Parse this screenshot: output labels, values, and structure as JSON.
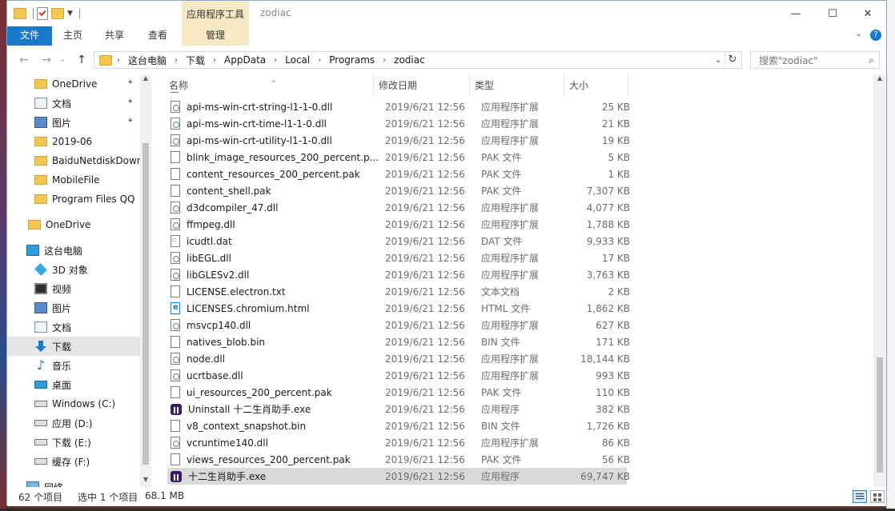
{
  "window": {
    "title": "zodiac",
    "tool_tab": "应用程序工具",
    "minimize": "—",
    "maximize": "☐",
    "close": "✕"
  },
  "ribbon": {
    "tabs": [
      {
        "label": "文件"
      },
      {
        "label": "主页"
      },
      {
        "label": "共享"
      },
      {
        "label": "查看"
      },
      {
        "label": "管理"
      }
    ],
    "expand": "⌄",
    "help": "?"
  },
  "nav": {
    "back": "←",
    "forward": "→",
    "history": "⌄",
    "up": "↑"
  },
  "address": {
    "crumbs": [
      "这台电脑",
      "下载",
      "AppData",
      "Local",
      "Programs",
      "zodiac"
    ],
    "dropdown": "⌄",
    "refresh": "↻"
  },
  "search": {
    "placeholder": "搜索\"zodiac\"",
    "icon": "⌕"
  },
  "sidebar": {
    "items": [
      {
        "label": "OneDrive",
        "icon": "folder-icon",
        "pinned": true
      },
      {
        "label": "文档",
        "icon": "document-icon",
        "pinned": true
      },
      {
        "label": "图片",
        "icon": "picture-icon",
        "pinned": true
      },
      {
        "label": "2019-06",
        "icon": "folder-icon",
        "pinned": false
      },
      {
        "label": "BaiduNetdiskDown",
        "icon": "folder-icon",
        "pinned": false
      },
      {
        "label": "MobileFile",
        "icon": "folder-icon",
        "pinned": false
      },
      {
        "label": "Program Files QQ",
        "icon": "folder-icon",
        "pinned": false
      },
      {
        "label": "OneDrive",
        "icon": "folder-icon",
        "pinned": false
      },
      {
        "label": "这台电脑",
        "icon": "computer-icon",
        "pinned": false
      },
      {
        "label": "3D 对象",
        "icon": "cube-icon",
        "pinned": false
      },
      {
        "label": "视频",
        "icon": "video-icon",
        "pinned": false
      },
      {
        "label": "图片",
        "icon": "picture-icon",
        "pinned": false
      },
      {
        "label": "文档",
        "icon": "document-icon",
        "pinned": false
      },
      {
        "label": "下载",
        "icon": "download-icon",
        "pinned": false,
        "selected": true
      },
      {
        "label": "音乐",
        "icon": "music-icon",
        "pinned": false
      },
      {
        "label": "桌面",
        "icon": "desktop-icon",
        "pinned": false
      },
      {
        "label": "Windows (C:)",
        "icon": "drive-icon",
        "pinned": false
      },
      {
        "label": "应用 (D:)",
        "icon": "drive-icon",
        "pinned": false
      },
      {
        "label": "下载 (E:)",
        "icon": "drive-icon",
        "pinned": false
      },
      {
        "label": "缓存 (F:)",
        "icon": "drive-icon",
        "pinned": false
      },
      {
        "label": "网络",
        "icon": "network-icon",
        "pinned": false
      }
    ],
    "pin_glyph": "📌"
  },
  "columns": {
    "name": "名称",
    "date": "修改日期",
    "type": "类型",
    "size": "大小",
    "sort_glyph": "^"
  },
  "files": [
    {
      "name": "api-ms-win-crt-string-l1-1-0.dll",
      "date": "2019/6/21 12:56",
      "type": "应用程序扩展",
      "size": "25 KB",
      "icon": "dll-icon"
    },
    {
      "name": "api-ms-win-crt-time-l1-1-0.dll",
      "date": "2019/6/21 12:56",
      "type": "应用程序扩展",
      "size": "21 KB",
      "icon": "dll-icon"
    },
    {
      "name": "api-ms-win-crt-utility-l1-1-0.dll",
      "date": "2019/6/21 12:56",
      "type": "应用程序扩展",
      "size": "19 KB",
      "icon": "dll-icon"
    },
    {
      "name": "blink_image_resources_200_percent.p...",
      "date": "2019/6/21 12:56",
      "type": "PAK 文件",
      "size": "5 KB",
      "icon": "file-icon"
    },
    {
      "name": "content_resources_200_percent.pak",
      "date": "2019/6/21 12:56",
      "type": "PAK 文件",
      "size": "1 KB",
      "icon": "file-icon"
    },
    {
      "name": "content_shell.pak",
      "date": "2019/6/21 12:56",
      "type": "PAK 文件",
      "size": "7,307 KB",
      "icon": "file-icon"
    },
    {
      "name": "d3dcompiler_47.dll",
      "date": "2019/6/21 12:56",
      "type": "应用程序扩展",
      "size": "4,077 KB",
      "icon": "dll-icon"
    },
    {
      "name": "ffmpeg.dll",
      "date": "2019/6/21 12:56",
      "type": "应用程序扩展",
      "size": "1,788 KB",
      "icon": "dll-icon"
    },
    {
      "name": "icudtl.dat",
      "date": "2019/6/21 12:56",
      "type": "DAT 文件",
      "size": "9,933 KB",
      "icon": "dat-icon"
    },
    {
      "name": "libEGL.dll",
      "date": "2019/6/21 12:56",
      "type": "应用程序扩展",
      "size": "17 KB",
      "icon": "dll-icon"
    },
    {
      "name": "libGLESv2.dll",
      "date": "2019/6/21 12:56",
      "type": "应用程序扩展",
      "size": "3,763 KB",
      "icon": "dll-icon"
    },
    {
      "name": "LICENSE.electron.txt",
      "date": "2019/6/21 12:56",
      "type": "文本文档",
      "size": "2 KB",
      "icon": "file-icon"
    },
    {
      "name": "LICENSES.chromium.html",
      "date": "2019/6/21 12:56",
      "type": "HTML 文件",
      "size": "1,862 KB",
      "icon": "html-icon"
    },
    {
      "name": "msvcp140.dll",
      "date": "2019/6/21 12:56",
      "type": "应用程序扩展",
      "size": "627 KB",
      "icon": "dll-icon"
    },
    {
      "name": "natives_blob.bin",
      "date": "2019/6/21 12:56",
      "type": "BIN 文件",
      "size": "171 KB",
      "icon": "file-icon"
    },
    {
      "name": "node.dll",
      "date": "2019/6/21 12:56",
      "type": "应用程序扩展",
      "size": "18,144 KB",
      "icon": "dll-icon"
    },
    {
      "name": "ucrtbase.dll",
      "date": "2019/6/21 12:56",
      "type": "应用程序扩展",
      "size": "993 KB",
      "icon": "dll-icon"
    },
    {
      "name": "ui_resources_200_percent.pak",
      "date": "2019/6/21 12:56",
      "type": "PAK 文件",
      "size": "110 KB",
      "icon": "file-icon"
    },
    {
      "name": "Uninstall 十二生肖助手.exe",
      "date": "2019/6/21 12:56",
      "type": "应用程序",
      "size": "382 KB",
      "icon": "app-icon"
    },
    {
      "name": "v8_context_snapshot.bin",
      "date": "2019/6/21 12:56",
      "type": "BIN 文件",
      "size": "1,726 KB",
      "icon": "file-icon"
    },
    {
      "name": "vcruntime140.dll",
      "date": "2019/6/21 12:56",
      "type": "应用程序扩展",
      "size": "86 KB",
      "icon": "dll-icon"
    },
    {
      "name": "views_resources_200_percent.pak",
      "date": "2019/6/21 12:56",
      "type": "PAK 文件",
      "size": "56 KB",
      "icon": "file-icon"
    },
    {
      "name": "十二生肖助手.exe",
      "date": "2019/6/21 12:56",
      "type": "应用程序",
      "size": "69,747 KB",
      "icon": "app-icon",
      "selected": true
    }
  ],
  "status": {
    "count": "62 个项目",
    "selection": "选中 1 个项目",
    "size": "68.1 MB"
  }
}
